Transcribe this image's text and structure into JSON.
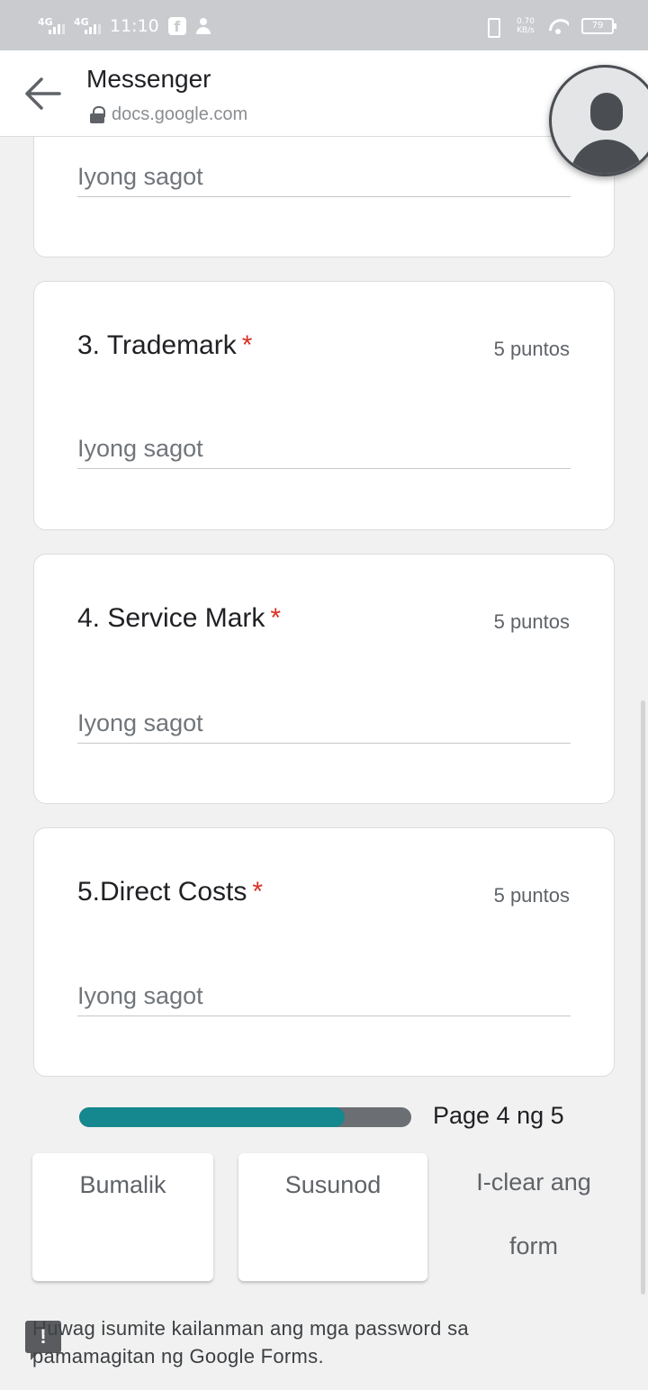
{
  "status_bar": {
    "network_1": "4G",
    "network_2": "4G",
    "time": "11:10",
    "facebook_icon_text": "f",
    "speed_value": "0.70",
    "speed_unit": "KB/s",
    "battery": "79"
  },
  "app_bar": {
    "title": "Messenger",
    "url": "docs.google.com"
  },
  "questions": [
    {
      "placeholder": "Iyong sagot"
    },
    {
      "title": "3. Trademark",
      "required_mark": "*",
      "points": "5 puntos",
      "placeholder": "Iyong sagot"
    },
    {
      "title": "4. Service Mark",
      "required_mark": "*",
      "points": "5 puntos",
      "placeholder": "Iyong sagot"
    },
    {
      "title": "5.Direct Costs",
      "required_mark": "*",
      "points": "5 puntos",
      "placeholder": "Iyong sagot"
    }
  ],
  "progress": {
    "fraction": 0.8,
    "label": "Page 4 ng 5",
    "fill_color": "#15878f",
    "track_color": "#6b6f74"
  },
  "buttons": {
    "back": "Bumalik",
    "next": "Susunod",
    "clear_line1": "I-clear ang",
    "clear_line2": "form"
  },
  "footer": {
    "note": "Huwag isumite kailanman ang mga password sa pamamagitan ng Google Forms.",
    "feedback_icon_text": "!"
  },
  "colors": {
    "required": "#d93025",
    "accent": "#15878f"
  }
}
